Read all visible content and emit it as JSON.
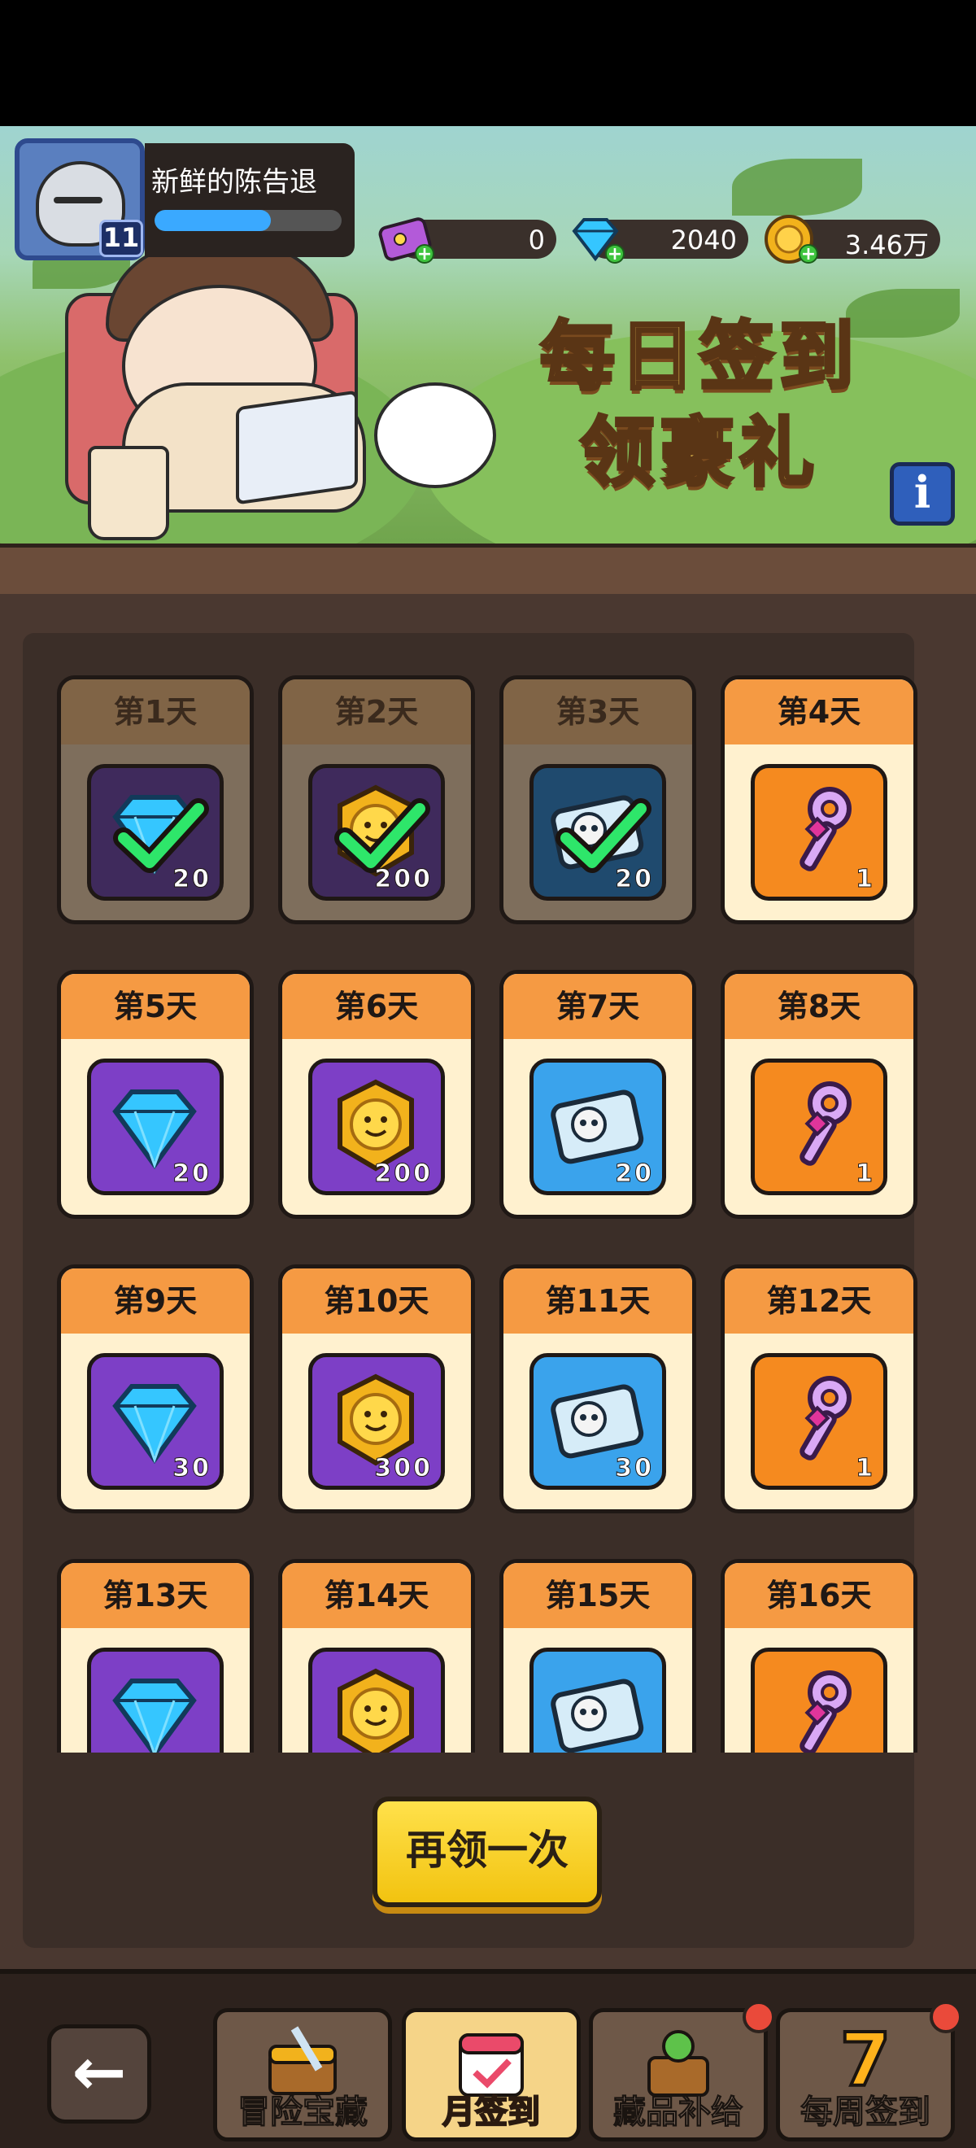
{
  "player": {
    "name": "新鲜的陈告退",
    "level": "11",
    "xp_fraction": 0.62
  },
  "currencies": [
    {
      "name": "ticket",
      "icon": "ticket-icon",
      "value": "0"
    },
    {
      "name": "diamond",
      "icon": "diamond-icon",
      "value": "2040"
    },
    {
      "name": "gold",
      "icon": "gold-coin-icon",
      "value": "3.46万"
    }
  ],
  "banner": {
    "title_line1": "每日签到",
    "title_line2": "领豪礼",
    "info_label": "i"
  },
  "days": [
    {
      "label": "第1天",
      "reward": "diamond",
      "amount": "20",
      "claimed": true
    },
    {
      "label": "第2天",
      "reward": "medal",
      "amount": "200",
      "claimed": true
    },
    {
      "label": "第3天",
      "reward": "skull-ticket",
      "amount": "20",
      "claimed": true
    },
    {
      "label": "第4天",
      "reward": "key",
      "amount": "1",
      "claimed": false
    },
    {
      "label": "第5天",
      "reward": "diamond",
      "amount": "20",
      "claimed": false
    },
    {
      "label": "第6天",
      "reward": "medal",
      "amount": "200",
      "claimed": false
    },
    {
      "label": "第7天",
      "reward": "skull-ticket",
      "amount": "20",
      "claimed": false
    },
    {
      "label": "第8天",
      "reward": "key",
      "amount": "1",
      "claimed": false
    },
    {
      "label": "第9天",
      "reward": "diamond",
      "amount": "30",
      "claimed": false
    },
    {
      "label": "第10天",
      "reward": "medal",
      "amount": "300",
      "claimed": false
    },
    {
      "label": "第11天",
      "reward": "skull-ticket",
      "amount": "30",
      "claimed": false
    },
    {
      "label": "第12天",
      "reward": "key",
      "amount": "1",
      "claimed": false
    },
    {
      "label": "第13天",
      "reward": "diamond",
      "amount": "",
      "claimed": false
    },
    {
      "label": "第14天",
      "reward": "medal",
      "amount": "",
      "claimed": false
    },
    {
      "label": "第15天",
      "reward": "skull-ticket",
      "amount": "",
      "claimed": false
    },
    {
      "label": "第16天",
      "reward": "key",
      "amount": "",
      "claimed": false
    }
  ],
  "again_button": "再领一次",
  "nav": {
    "back_icon": "back-arrow-icon",
    "items": [
      {
        "label": "冒险宝藏",
        "icon": "treasure-chest-sword-icon",
        "active": false,
        "badge": false
      },
      {
        "label": "月签到",
        "icon": "calendar-check-icon",
        "active": true,
        "badge": false
      },
      {
        "label": "藏品补给",
        "icon": "trophy-chest-icon",
        "active": false,
        "badge": true
      },
      {
        "label": "每周签到",
        "icon": "seven-gift-icon",
        "active": false,
        "badge": true
      }
    ]
  },
  "colors": {
    "header_orange": "#f59a43",
    "tile_purple": "#7d3fc6",
    "tile_orange": "#f58a1f",
    "tile_blue": "#3aa3ec",
    "claimed_check": "#2ee66a",
    "button_yellow": "#ffe14b"
  }
}
